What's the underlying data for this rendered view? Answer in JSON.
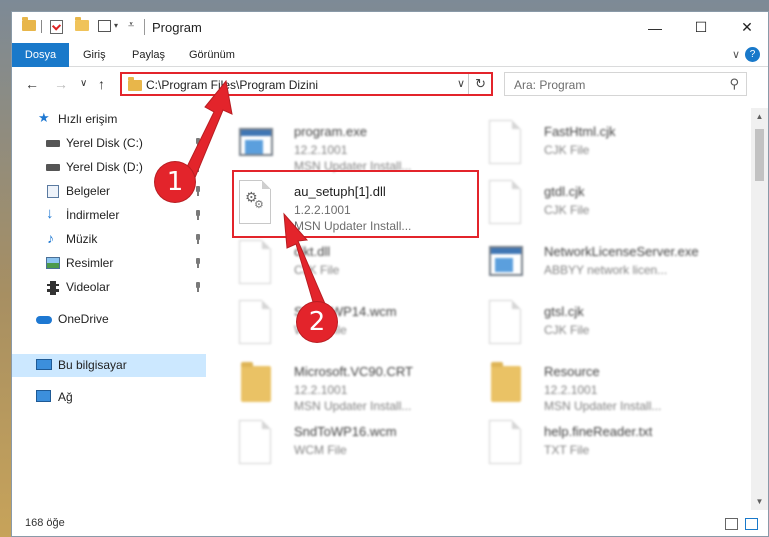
{
  "window": {
    "title": "Program",
    "controls": {
      "minimize": "—",
      "maximize": "☐",
      "close": "✕"
    }
  },
  "ribbon": {
    "tabs": [
      {
        "label": "Dosya",
        "active": true
      },
      {
        "label": "Giriş",
        "active": false
      },
      {
        "label": "Paylaş",
        "active": false
      },
      {
        "label": "Görünüm",
        "active": false
      }
    ],
    "collapse_glyph": "∨",
    "help_glyph": "?"
  },
  "nav": {
    "back": "←",
    "forward": "→",
    "recent": "∨",
    "up": "↑",
    "address": "C:\\Program Files\\Program Dizini",
    "address_dropdown": "∨",
    "refresh": "↻",
    "search_placeholder": "Ara: Program",
    "search_icon": "⚲"
  },
  "sidebar": {
    "items": [
      {
        "label": "Hızlı erişim",
        "icon": "star-icon",
        "pinned": false
      },
      {
        "label": "Yerel Disk (C:)",
        "icon": "drive-icon",
        "pinned": true
      },
      {
        "label": "Yerel Disk (D:)",
        "icon": "drive-icon",
        "pinned": true
      },
      {
        "label": "Belgeler",
        "icon": "documents-icon",
        "pinned": true
      },
      {
        "label": "İndirmeler",
        "icon": "download-icon",
        "pinned": true
      },
      {
        "label": "Müzik",
        "icon": "music-icon",
        "pinned": true
      },
      {
        "label": "Resimler",
        "icon": "pictures-icon",
        "pinned": true
      },
      {
        "label": "Videolar",
        "icon": "videos-icon",
        "pinned": true
      },
      {
        "label": "OneDrive",
        "icon": "cloud-icon",
        "pinned": false
      },
      {
        "label": "Bu bilgisayar",
        "icon": "computer-icon",
        "pinned": false,
        "selected": true
      },
      {
        "label": "Ağ",
        "icon": "network-icon",
        "pinned": false
      }
    ]
  },
  "files": [
    {
      "name": "program.exe",
      "line1": "12.2.1001",
      "line2": "MSN Updater Install...",
      "kind": "exe",
      "blurred": true
    },
    {
      "name": "FastHtml.cjk",
      "line1": "CJK File",
      "line2": "",
      "kind": "doc",
      "blurred": true
    },
    {
      "name": "au_setuph[1].dll",
      "line1": "1.2.2.1001",
      "line2": "MSN Updater Install...",
      "kind": "dll",
      "blurred": false
    },
    {
      "name": "gtdl.cjk",
      "line1": "CJK File",
      "line2": "",
      "kind": "doc",
      "blurred": true
    },
    {
      "name": "cjkt.dll",
      "line1": "CJK File",
      "line2": "",
      "kind": "doc",
      "blurred": true
    },
    {
      "name": "NetworkLicenseServer.exe",
      "line1": "ABBYY network licen...",
      "line2": "",
      "kind": "exe",
      "blurred": true
    },
    {
      "name": "SndToWP14.wcm",
      "line1": "WCM File",
      "line2": "",
      "kind": "doc",
      "blurred": true
    },
    {
      "name": "gtsl.cjk",
      "line1": "CJK File",
      "line2": "",
      "kind": "doc",
      "blurred": true
    },
    {
      "name": "Microsoft.VC90.CRT",
      "line1": "12.2.1001",
      "line2": "MSN Updater Install...",
      "kind": "folder",
      "blurred": true
    },
    {
      "name": "Resource",
      "line1": "12.2.1001",
      "line2": "MSN Updater Install...",
      "kind": "folder",
      "blurred": true
    },
    {
      "name": "SndToWP16.wcm",
      "line1": "WCM File",
      "line2": "",
      "kind": "doc",
      "blurred": true
    },
    {
      "name": "help.fineReader.txt",
      "line1": "TXT File",
      "line2": "",
      "kind": "doc",
      "blurred": true
    }
  ],
  "status": {
    "item_count": "168 öğe"
  },
  "callouts": [
    {
      "label": "1"
    },
    {
      "label": "2"
    }
  ],
  "colors": {
    "accent": "#1979ca",
    "highlight": "#e3242b",
    "selected": "#cce8ff"
  }
}
